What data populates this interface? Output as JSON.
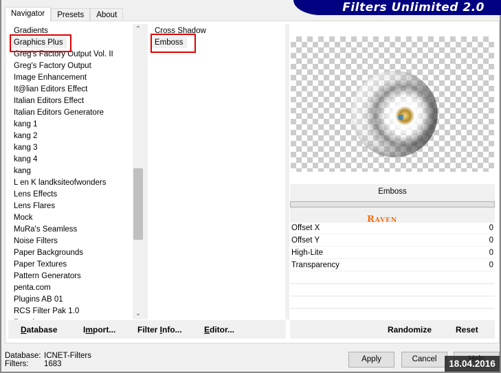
{
  "app": {
    "title": "Filters Unlimited 2.0"
  },
  "tabs": [
    {
      "label": "Navigator",
      "active": true
    },
    {
      "label": "Presets",
      "active": false
    },
    {
      "label": "About",
      "active": false
    }
  ],
  "categories": {
    "selected": "Graphics Plus",
    "items": [
      "Gradients",
      "Graphics Plus",
      "Greg's Factory Output Vol. II",
      "Greg's Factory Output",
      "Image Enhancement",
      "It@lian Editors Effect",
      "Italian Editors Effect",
      "Italian Editors Generatore",
      "kang 1",
      "kang 2",
      "kang 3",
      "kang 4",
      "kang",
      "L en K landksiteofwonders",
      "Lens Effects",
      "Lens Flares",
      "Mock",
      "MuRa's Seamless",
      "Noise Filters",
      "Paper Backgrounds",
      "Paper Textures",
      "Pattern Generators",
      "penta.com",
      "Plugins AB 01",
      "RCS Filter Pak 1.0",
      "Renaissance"
    ],
    "scroll_up_icon": "chevron-up",
    "scroll_down_icon": "chevron-down"
  },
  "filters": {
    "selected": "Emboss",
    "items": [
      "Cross Shadow",
      "Emboss"
    ]
  },
  "parameters": {
    "title": "Emboss",
    "watermark": "Raven",
    "rows": [
      {
        "label": "Offset X",
        "value": "0"
      },
      {
        "label": "Offset Y",
        "value": "0"
      },
      {
        "label": "High-Lite",
        "value": "0"
      },
      {
        "label": "Transparency",
        "value": "0"
      }
    ]
  },
  "toolbar": {
    "database": {
      "mnemonic": "D",
      "rest": "atabase"
    },
    "import": {
      "pre": "I",
      "mnemonic": "m",
      "rest": "port..."
    },
    "filter_info": {
      "pre": "Filter ",
      "mnemonic": "I",
      "rest": "nfo..."
    },
    "editor": {
      "mnemonic": "E",
      "rest": "ditor..."
    },
    "randomize": "Randomize",
    "reset": "Reset"
  },
  "status": {
    "database_label": "Database:",
    "database_value": "ICNET-Filters",
    "filters_label": "Filters:",
    "filters_value": "1683"
  },
  "buttons": {
    "apply": "Apply",
    "cancel": "Cancel",
    "help": "Help"
  },
  "date_badge": "18.04.2016"
}
